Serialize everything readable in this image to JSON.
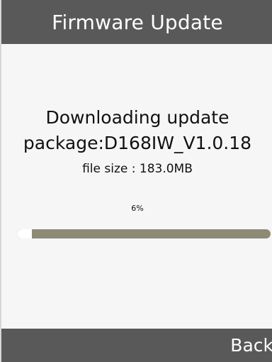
{
  "header": {
    "title": "Firmware Update"
  },
  "status": {
    "line1": "Downloading update",
    "line2": "package:D168IW_V1.0.18",
    "file_size": "file size : 183.0MB"
  },
  "progress": {
    "percent_label": "6%",
    "fraction": 0.06
  },
  "footer": {
    "back_label": "Back"
  },
  "colors": {
    "bar_background": "#595959",
    "screen_background": "#f6f6f6",
    "progress_track": "#8d8a76",
    "progress_fill": "#ffffff",
    "text": "#111111"
  }
}
